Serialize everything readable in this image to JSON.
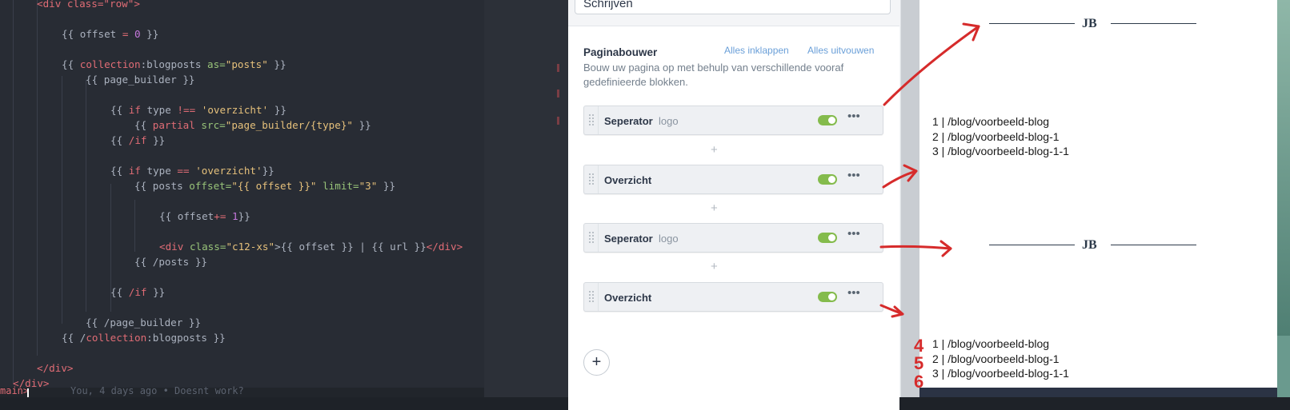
{
  "editor": {
    "lines": [
      [
        {
          "t": "<div class=\"row\">",
          "c": "k"
        }
      ],
      [],
      [
        {
          "t": "{{ "
        },
        {
          "t": "offset",
          "c": ""
        },
        {
          "t": " = ",
          "c": "k"
        },
        {
          "t": "0",
          "c": "n"
        },
        {
          "t": " }}"
        }
      ],
      [],
      [
        {
          "t": "{{ "
        },
        {
          "t": "collection",
          "c": "k"
        },
        {
          "t": ":blogposts "
        },
        {
          "t": "as=",
          "c": "a"
        },
        {
          "t": "\"posts\"",
          "c": "s"
        },
        {
          "t": " }}"
        }
      ],
      [
        {
          "t": "{{ page_builder }}"
        }
      ],
      [],
      [
        {
          "t": "{{ "
        },
        {
          "t": "if",
          "c": "k"
        },
        {
          "t": " type "
        },
        {
          "t": "!==",
          "c": "k"
        },
        {
          "t": " "
        },
        {
          "t": "'overzicht'",
          "c": "s"
        },
        {
          "t": " }}"
        }
      ],
      [
        {
          "t": "{{ "
        },
        {
          "t": "partial",
          "c": "k"
        },
        {
          "t": " "
        },
        {
          "t": "src=",
          "c": "a"
        },
        {
          "t": "\"page_builder/{type}\"",
          "c": "s"
        },
        {
          "t": " }}"
        }
      ],
      [
        {
          "t": "{{ "
        },
        {
          "t": "/if",
          "c": "k"
        },
        {
          "t": " }}"
        }
      ],
      [],
      [
        {
          "t": "{{ "
        },
        {
          "t": "if",
          "c": "k"
        },
        {
          "t": " type "
        },
        {
          "t": "==",
          "c": "k"
        },
        {
          "t": " "
        },
        {
          "t": "'overzicht'",
          "c": "s"
        },
        {
          "t": "}}"
        }
      ],
      [
        {
          "t": "{{ posts "
        },
        {
          "t": "offset=",
          "c": "a"
        },
        {
          "t": "\"{{ offset }}\"",
          "c": "s"
        },
        {
          "t": " "
        },
        {
          "t": "limit=",
          "c": "a"
        },
        {
          "t": "\"3\"",
          "c": "s"
        },
        {
          "t": " }}"
        }
      ],
      [],
      [
        {
          "t": "{{ offset"
        },
        {
          "t": "+=",
          "c": "k"
        },
        {
          "t": " "
        },
        {
          "t": "1",
          "c": "n"
        },
        {
          "t": "}}"
        }
      ],
      [],
      [
        {
          "t": "<div",
          "c": "k"
        },
        {
          "t": " "
        },
        {
          "t": "class=",
          "c": "a"
        },
        {
          "t": "\"c12-xs\"",
          "c": "s"
        },
        {
          "t": ">{{ offset }} | {{ url }}"
        },
        {
          "t": "</div>",
          "c": "k"
        }
      ],
      [
        {
          "t": "{{ /posts }}"
        }
      ],
      [],
      [
        {
          "t": "{{ "
        },
        {
          "t": "/if",
          "c": "k"
        },
        {
          "t": " }}"
        }
      ],
      [],
      [
        {
          "t": "{{ /page_builder }}"
        }
      ],
      [
        {
          "t": "{{ /"
        },
        {
          "t": "collection",
          "c": "k"
        },
        {
          "t": ":blogposts }}"
        }
      ],
      [],
      [
        {
          "t": "</div>",
          "c": "k"
        }
      ],
      [
        {
          "t": "</div>",
          "c": "k"
        }
      ]
    ],
    "status_branch": "main>",
    "blame": "You, 4 days ago • Doesnt work?"
  },
  "cms": {
    "input_value": "Schrijven",
    "pb_title": "Paginabouwer",
    "collapse_label": "Alles inklappen",
    "expand_label": "Alles uitvouwen",
    "pb_description": "Bouw uw pagina op met behulp van verschillende vooraf gedefinieerde blokken.",
    "blocks": [
      {
        "name": "Seperator",
        "sub": "logo",
        "enabled": true
      },
      {
        "name": "Overzicht",
        "sub": "",
        "enabled": true
      },
      {
        "name": "Seperator",
        "sub": "logo",
        "enabled": true
      },
      {
        "name": "Overzicht",
        "sub": "",
        "enabled": true
      }
    ],
    "plus_label": "+",
    "more_label": "•••",
    "add_label": "+"
  },
  "preview": {
    "logo_text": "JB",
    "list1": [
      "1 | /blog/voorbeeld-blog",
      "2 | /blog/voorbeeld-blog-1",
      "3 | /blog/voorbeeld-blog-1-1"
    ],
    "list2": [
      "1 | /blog/voorbeeld-blog",
      "2 | /blog/voorbeeld-blog-1",
      "3 | /blog/voorbeeld-blog-1-1"
    ]
  },
  "annotations": {
    "numbers": [
      "4",
      "5",
      "6"
    ],
    "color": "#d62b2b"
  }
}
